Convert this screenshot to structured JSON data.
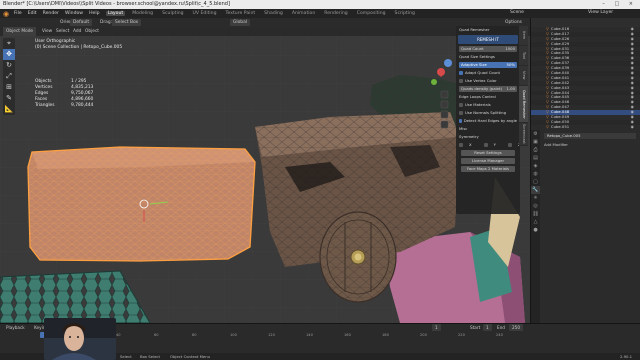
{
  "window": {
    "title": "Blender* [C:\\Users\\DMI\\Videos\\\\Split Videos - browser.school@yandex.ru\\Split\\c_4_5.blend]",
    "controls": "–  □  ×"
  },
  "menubar": {
    "items": [
      "File",
      "Edit",
      "Render",
      "Window",
      "Help"
    ],
    "workspaces": [
      "Layout",
      "Modeling",
      "Sculpting",
      "UV Editing",
      "Texture Paint",
      "Shading",
      "Animation",
      "Rendering",
      "Compositing",
      "Scripting"
    ],
    "active_workspace": "Layout",
    "scene": "Scene",
    "view_layer": "View Layer"
  },
  "header": {
    "orientation_label": "Orientation:",
    "orientation_value": "Default",
    "drag_label": "Drag:",
    "drag_value": "Select Box",
    "pivot": "Global",
    "options": "Options"
  },
  "viewport_header": {
    "mode": "Object Mode",
    "view": "View",
    "select": "Select",
    "add": "Add",
    "object": "Object"
  },
  "overlay": {
    "view_name": "User Orthographic",
    "collection": "(0) Scene Collection | Retopo_Cube.005"
  },
  "stats": [
    {
      "k": "Objects",
      "v": "1 / 295"
    },
    {
      "k": "Vertices",
      "v": "4,835,213"
    },
    {
      "k": "Edges",
      "v": "9,750,067"
    },
    {
      "k": "Faces",
      "v": "4,896,660"
    },
    {
      "k": "Triangles",
      "v": "9,780,444"
    }
  ],
  "toolbar_icons": [
    "cursor-icon",
    "move-icon",
    "rotate-icon",
    "scale-icon",
    "transform-icon",
    "annotate-icon",
    "measure-icon"
  ],
  "quad_panel": {
    "title": "Quad Remesher",
    "brand": "REMESH IT",
    "quad_count_label": "Quad Count",
    "quad_count_value": "1000",
    "adaptive_label": "Quad Size Settings",
    "adaptive_size_label": "Adaptive Size",
    "adaptive_size_value": "50%",
    "adapt_quad_count": "Adapt Quad Count",
    "use_vertex_color": "Use Vertex Color",
    "density_label": "Quads density (paint)",
    "density_value": "1.00",
    "edge_loops_label": "Edge Loops Control",
    "use_materials": "Use Materials",
    "use_normals": "Use Normals Splitting",
    "detect_hard": "Detect Hard Edges by angle",
    "misc_label": "Misc",
    "symmetry_label": "Symmetry",
    "sym_x": "X",
    "sym_y": "Y",
    "sym_z": "Z",
    "reset_btn": "Reset Settings",
    "license_btn": "License Manager",
    "maps_btn": "Face Maps 2 Materials"
  },
  "side_tabs": [
    "Item",
    "Tool",
    "View",
    "Quad Remesher",
    "Screencast"
  ],
  "outliner": {
    "items": [
      "Cube.016",
      "Cube.017",
      "Cube.026",
      "Cube.029",
      "Cube.031",
      "Cube.035",
      "Cube.036",
      "Cube.037",
      "Cube.039",
      "Cube.040",
      "Cube.041",
      "Cube.042",
      "Cube.043",
      "Cube.044",
      "Cube.045",
      "Cube.046",
      "Cube.047",
      "Cube.048",
      "Cube.049",
      "Cube.050",
      "Cube.051"
    ],
    "selected_index": 17
  },
  "properties": {
    "object_name": "Retopo_Cube.005",
    "add_modifier": "Add Modifier"
  },
  "timeline": {
    "playback": "Playback",
    "keying": "Keying",
    "view": "View",
    "marker": "Marker",
    "current_frame": "1",
    "start_label": "Start",
    "start": "1",
    "end_label": "End",
    "end": "250",
    "ruler": [
      "0",
      "20",
      "40",
      "60",
      "80",
      "100",
      "120",
      "140",
      "160",
      "180",
      "200",
      "220",
      "240"
    ]
  },
  "status": {
    "select": "Select",
    "box_select": "Box Select",
    "rotate_view": "Rotate View",
    "context_menu": "Object Context Menu",
    "version": "2.90.1"
  },
  "colors": {
    "selected_orange": "#e8923a",
    "accent_blue": "#4772b3"
  }
}
